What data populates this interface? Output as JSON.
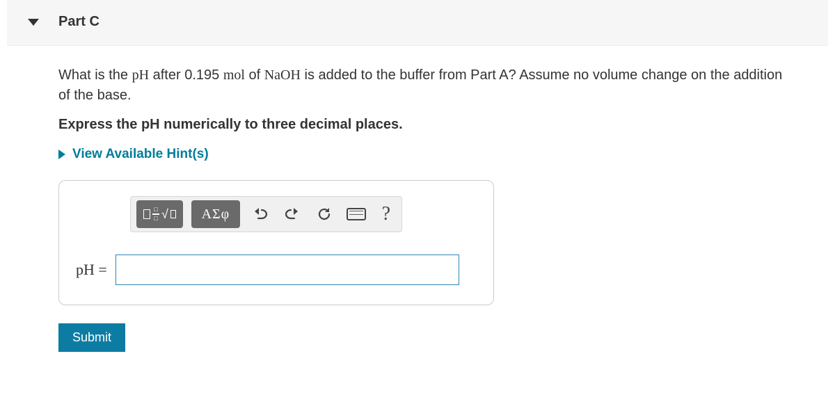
{
  "header": {
    "title": "Part C"
  },
  "question": {
    "pre": "What is the ",
    "pH": "pH",
    "mid1": " after 0.195 ",
    "mol": "mol",
    "mid2": " of ",
    "naoh": "NaOH",
    "post": " is added to the buffer from Part A? Assume no volume change on the addition of the base."
  },
  "instruction": "Express the pH numerically to three decimal places.",
  "hints_label": "View Available Hint(s)",
  "toolbar": {
    "greek_label": "ΑΣφ"
  },
  "input": {
    "lhs": "pH =",
    "value": ""
  },
  "submit_label": "Submit",
  "help_label": "?"
}
